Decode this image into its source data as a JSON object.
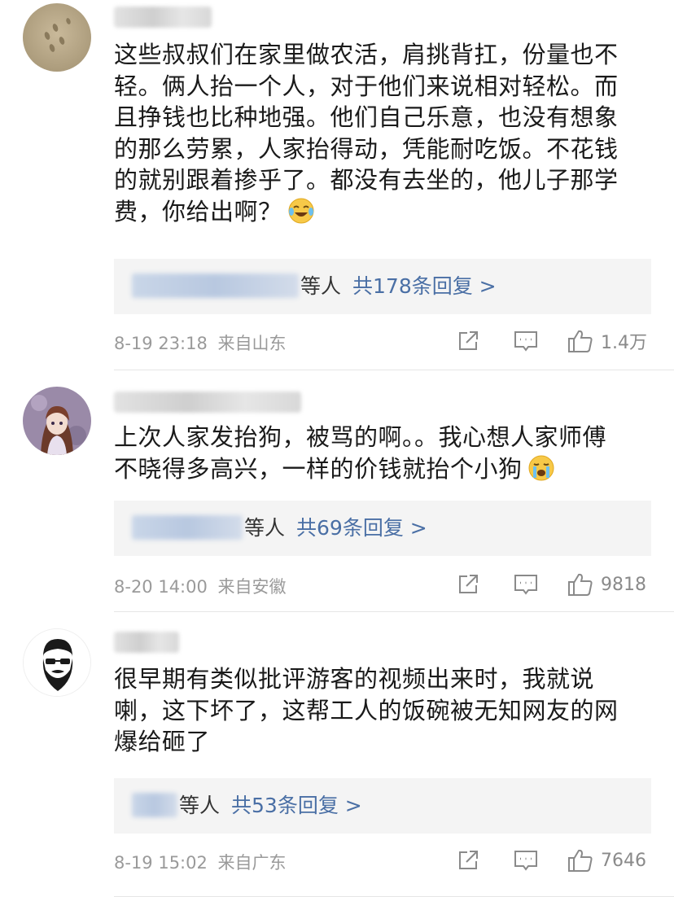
{
  "comments": [
    {
      "text_lines": [
        "这些叔叔们在家里做农活，肩挑背扛，份量也不",
        "轻。俩人抬一个人，对于他们来说相对轻松。而",
        "且挣钱也比种地强。他们自己乐意，也没有想象",
        "的那么劳累，人家抬得动，凭能耐吃饭。不花钱",
        "的就别跟着掺乎了。都没有去坐的，他儿子那学",
        "费，你给出啊？"
      ],
      "emoji": "laughing-crying-emoji",
      "reply_etc": "等人",
      "reply_count": "共178条回复 >",
      "date": "8-19 23:18",
      "location": "来自山东",
      "likes": "1.4万"
    },
    {
      "text_lines": [
        "上次人家发抬狗，被骂的啊。。我心想人家师傅",
        "不晓得多高兴，一样的价钱就抬个小狗"
      ],
      "emoji": "crying-emoji",
      "reply_etc": "等人",
      "reply_count": "共69条回复 >",
      "date": "8-20 14:00",
      "location": "来自安徽",
      "likes": "9818"
    },
    {
      "text_lines": [
        "很早期有类似批评游客的视频出来时，我就说",
        "喇，这下坏了，这帮工人的饭碗被无知网友的网",
        "爆给砸了"
      ],
      "emoji": "",
      "reply_etc": "等人",
      "reply_count": "共53条回复 >",
      "date": "8-19 15:02",
      "location": "来自广东",
      "likes": "7646"
    }
  ],
  "colors": {
    "reply_link": "#4a6fa5",
    "meta_text": "#9a9a9a",
    "reply_bg": "#f4f4f4"
  }
}
